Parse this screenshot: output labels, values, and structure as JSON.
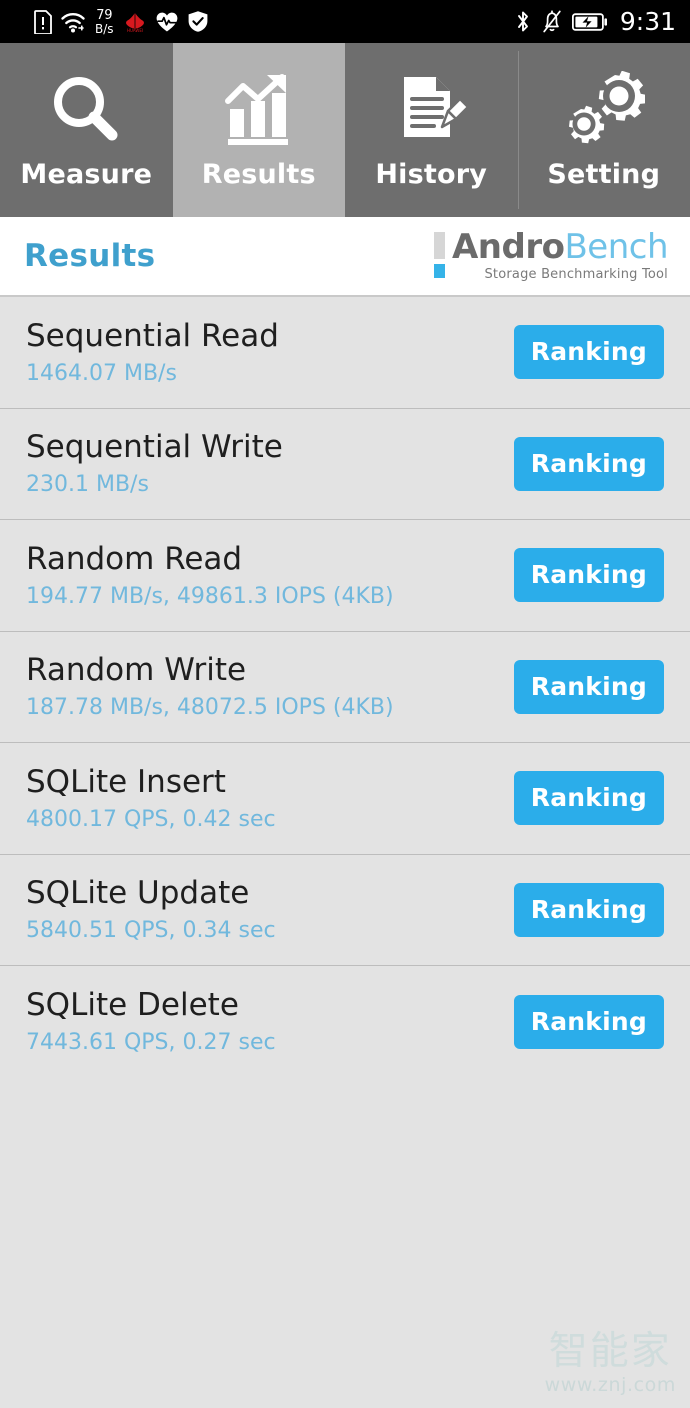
{
  "statusbar": {
    "left_icons": [
      "sim-card-icon",
      "wifi-icon",
      "huawei-logo-icon",
      "heart-rate-icon",
      "shield-check-icon"
    ],
    "network_speed_value": "79",
    "network_speed_unit": "B/s",
    "right_icons": [
      "bluetooth-icon",
      "mute-bell-icon",
      "battery-charging-icon"
    ],
    "clock": "9:31"
  },
  "tabs": [
    {
      "label": "Measure",
      "icon": "magnifier-icon",
      "active": false
    },
    {
      "label": "Results",
      "icon": "bar-chart-arrow-icon",
      "active": true
    },
    {
      "label": "History",
      "icon": "document-pencil-icon",
      "active": false
    },
    {
      "label": "Setting",
      "icon": "gears-icon",
      "active": false
    }
  ],
  "header": {
    "title": "Results",
    "logo_primary": "Andro",
    "logo_secondary": "Bench",
    "logo_tagline": "Storage Benchmarking Tool"
  },
  "results": {
    "button_label": "Ranking",
    "rows": [
      {
        "title": "Sequential Read",
        "value": "1464.07 MB/s"
      },
      {
        "title": "Sequential Write",
        "value": "230.1 MB/s"
      },
      {
        "title": "Random Read",
        "value": "194.77 MB/s, 49861.3 IOPS (4KB)"
      },
      {
        "title": "Random Write",
        "value": "187.78 MB/s, 48072.5 IOPS (4KB)"
      },
      {
        "title": "SQLite Insert",
        "value": "4800.17 QPS, 0.42 sec"
      },
      {
        "title": "SQLite Update",
        "value": "5840.51 QPS, 0.34 sec"
      },
      {
        "title": "SQLite Delete",
        "value": "7443.61 QPS, 0.27 sec"
      }
    ]
  },
  "watermark": {
    "text_cn": "智能家",
    "url": "www.znj.com"
  },
  "colors": {
    "accent_blue": "#2badea",
    "value_blue": "#71b8dd",
    "title_blue": "#3fa0cd",
    "tabbar_bg": "#6e6e6e",
    "tab_active_bg": "#b2b2b2",
    "list_bg": "#e3e3e3",
    "statusbar_bg": "#000000"
  }
}
